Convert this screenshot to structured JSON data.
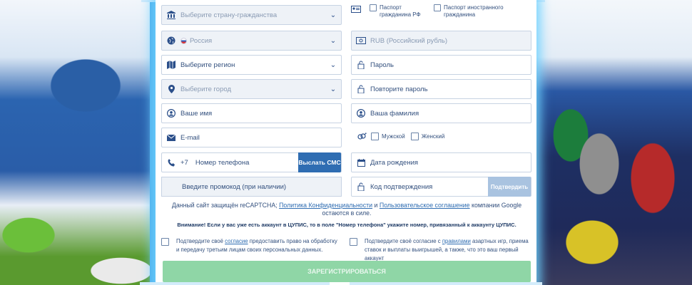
{
  "form": {
    "citizenship_placeholder": "Выберите страну-гражданства",
    "passport_rf": "Паспорт гражданина РФ",
    "passport_foreign": "Паспорт иностранного гражданина",
    "country_value": "Россия",
    "currency_value": "RUB (Российский рубль)",
    "region_placeholder": "Выберите регион",
    "password_placeholder": "Пароль",
    "city_placeholder": "Выберите город",
    "repeat_password_placeholder": "Повторите пароль",
    "first_name_placeholder": "Ваше имя",
    "last_name_placeholder": "Ваша фамилия",
    "email_placeholder": "E-mail",
    "gender_male": "Мужской",
    "gender_female": "Женский",
    "phone_prefix": "+7",
    "phone_placeholder": "Номер телефона",
    "send_sms_label": "Выслать СМС",
    "birthdate_placeholder": "Дата рождения",
    "promo_placeholder": "Введите промокод (при наличии)",
    "confirm_code_placeholder": "Код подтверждения",
    "confirm_button_label": "Подтвердить",
    "recaptcha_text_1": "Данный сайт защищён reCAPTCHA;",
    "privacy_link": "Политика Конфиденциальности",
    "recaptcha_and": "и",
    "terms_link": "Пользовательское соглашение",
    "recaptcha_text_2": "компании Google остаются в силе.",
    "warning_text": "Внимание! Если у вас уже есть аккаунт в ЦУПИС, то в поле \"Номер телефона\" укажите номер, привязанный к аккаунту ЦУПИС.",
    "consent1_prefix": "Подтвердите своё",
    "consent1_link": "согласие",
    "consent1_suffix": "предоставить право на обработку и передачу третьим лицам своих персональных данных.",
    "consent2_prefix": "Подтвердите своё согласие с",
    "consent2_link": "правилами",
    "consent2_suffix": "азартных игр, приема ставок и выплаты выигрышей, а также, что это ваш первый аккаунт",
    "submit_label": "ЗАРЕГИСТРИРОВАТЬСЯ"
  },
  "icons": {
    "citizenship": "bank-icon",
    "passport": "id-card-icon",
    "country": "globe-icon",
    "currency": "money-icon",
    "region": "map-icon",
    "password": "lock-icon",
    "city": "map-pin-icon",
    "user": "user-icon",
    "email": "envelope-icon",
    "gender": "gender-icon",
    "phone": "phone-icon",
    "calendar": "calendar-icon"
  },
  "colors": {
    "primary": "#2f6db2",
    "submit_disabled": "#8fd6a6",
    "confirm_disabled": "#a9c3e0"
  }
}
